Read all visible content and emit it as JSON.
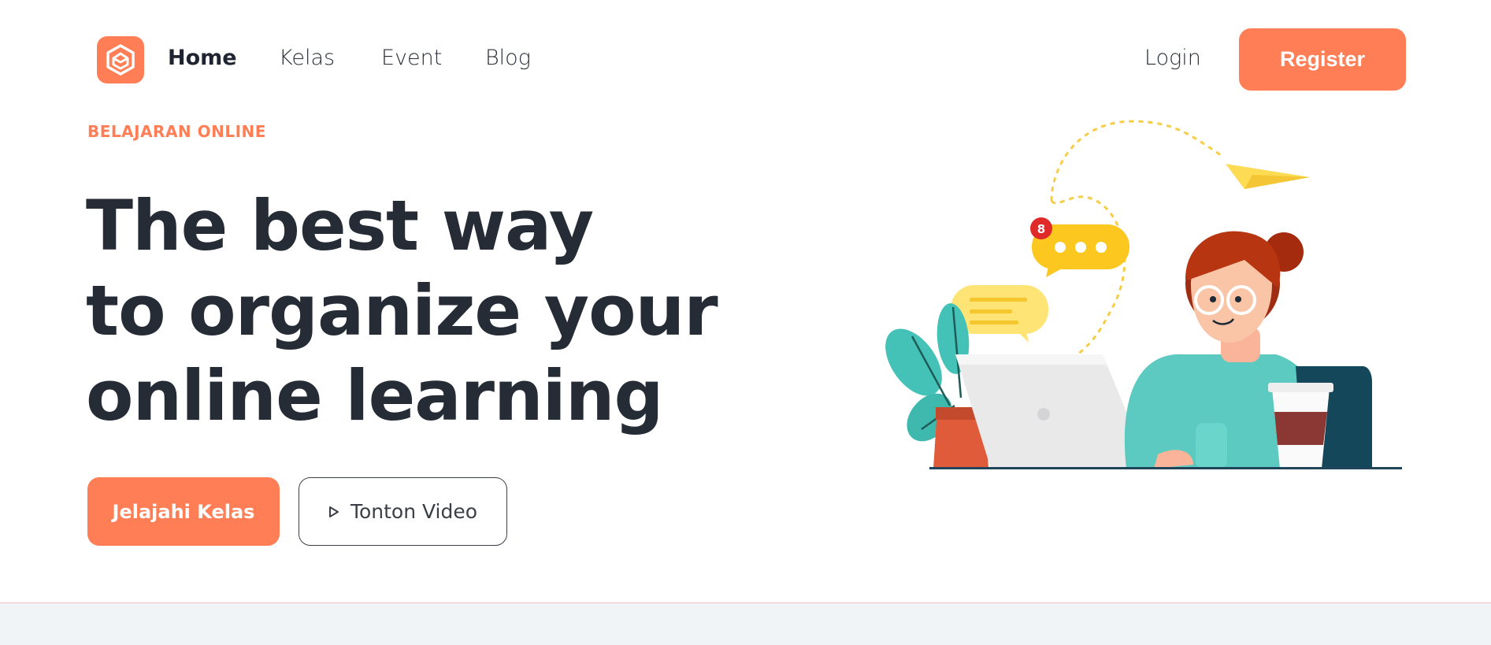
{
  "nav": {
    "logo_icon": "hexagon-logo-icon",
    "links": [
      {
        "label": "Home",
        "active": true
      },
      {
        "label": "Kelas",
        "active": false
      },
      {
        "label": "Event",
        "active": false
      },
      {
        "label": "Blog",
        "active": false
      }
    ],
    "login_label": "Login",
    "register_label": "Register"
  },
  "hero": {
    "eyebrow": "BELAJARAN ONLINE",
    "headline_lines": [
      "The best way",
      "to organize your",
      "online learning"
    ],
    "primary_cta": "Jelajahi Kelas",
    "secondary_cta": "Tonton Video",
    "secondary_cta_icon": "play-icon",
    "notification_count": "8"
  },
  "colors": {
    "accent": "#ff7e56",
    "heading": "#262c36",
    "band": "#f1f4f7"
  }
}
